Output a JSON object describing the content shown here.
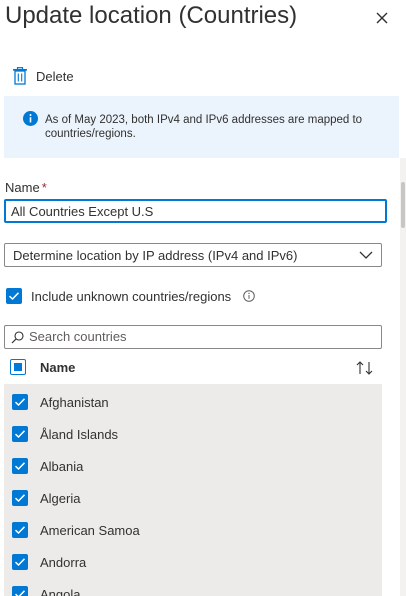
{
  "panel": {
    "title": "Update location (Countries)",
    "close_icon": "close-icon"
  },
  "toolbar": {
    "delete_label": "Delete",
    "delete_icon": "trash-icon"
  },
  "info_bar": {
    "text": "As of May 2023, both IPv4 and IPv6 addresses are mapped to countries/regions.",
    "icon": "info-icon",
    "color": "#ebf3fc"
  },
  "form": {
    "name_label": "Name",
    "required_mark": "*",
    "name_value": "All Countries Except U.S",
    "location_method": "Determine location by IP address (IPv4 and IPv6)",
    "include_unknown_label": "Include unknown countries/regions",
    "include_unknown_checked": true,
    "search_placeholder": "Search countries"
  },
  "table": {
    "column_name": "Name",
    "sort_icon": "sort-icon",
    "rows": [
      {
        "label": "Afghanistan",
        "checked": true
      },
      {
        "label": "Åland Islands",
        "checked": true
      },
      {
        "label": "Albania",
        "checked": true
      },
      {
        "label": "Algeria",
        "checked": true
      },
      {
        "label": "American Samoa",
        "checked": true
      },
      {
        "label": "Andorra",
        "checked": true
      },
      {
        "label": "Angola",
        "checked": true
      }
    ]
  },
  "colors": {
    "accent": "#0078d4",
    "required": "#a4262c",
    "list_bg": "#edebe9"
  }
}
